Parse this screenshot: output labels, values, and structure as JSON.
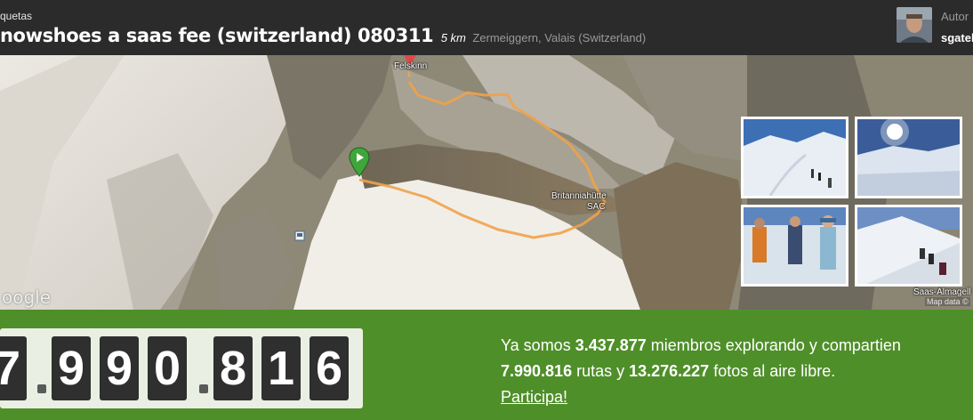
{
  "header": {
    "tag_label": "quetas",
    "title": "nowshoes a saas fee (switzerland) 080311",
    "distance": "5 km",
    "location": "Zermeiggern, Valais (Switzerland)",
    "author_label": "Autor",
    "author_name": "sgatel"
  },
  "map": {
    "provider_logo": "oogle",
    "labels": {
      "start_hut": "Felskinn",
      "end_hut_line1": "Britanniahütte",
      "end_hut_line2": "SAC",
      "village": "Saas-Almagell",
      "map_data": "Map data ©"
    },
    "markers": {
      "start": "green-flag-marker",
      "end": "red-pin-marker"
    },
    "route_color": "#f0a24a"
  },
  "photos": [
    {
      "name": "photo-ski-track"
    },
    {
      "name": "photo-sun-glacier"
    },
    {
      "name": "photo-hikers-group"
    },
    {
      "name": "photo-snow-slope"
    }
  ],
  "stats": {
    "counter_digits": [
      "7",
      "9",
      "9",
      "0",
      "8",
      "1",
      "6"
    ],
    "line1_prefix": "Ya somos ",
    "members": "3.437.877",
    "line1_suffix": " miembros explorando y compartien",
    "routes": "7.990.816",
    "line2_mid": " rutas y ",
    "photos_count": "13.276.227",
    "line2_suffix": " fotos al aire libre.",
    "cta": "Participa!"
  },
  "colors": {
    "header_bg": "#2b2b2b",
    "stats_bg": "#4f8f2a",
    "counter_bg": "#e9efe2",
    "digit_bg": "#2f2f2f"
  }
}
